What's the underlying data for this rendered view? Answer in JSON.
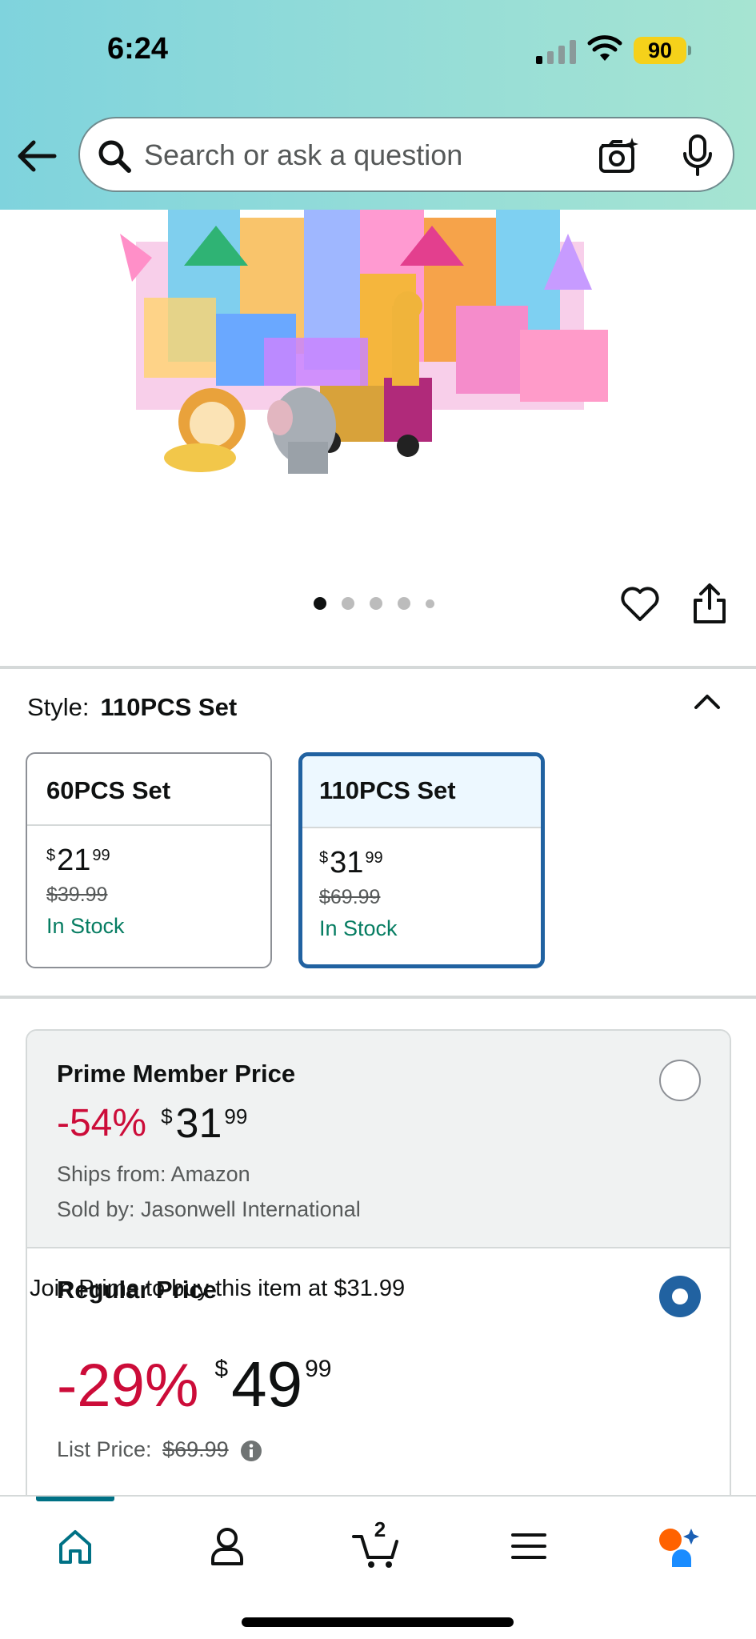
{
  "status_bar": {
    "time": "6:24",
    "battery": "90"
  },
  "search": {
    "placeholder": "Search or ask a question",
    "value": ""
  },
  "gallery": {
    "image_count": 5,
    "active_index": 0
  },
  "style": {
    "label": "Style:",
    "selected": "110PCS Set",
    "options": [
      {
        "name": "60PCS Set",
        "price_symbol": "$",
        "price_whole": "21",
        "price_fraction": "99",
        "list_price": "$39.99",
        "availability": "In Stock"
      },
      {
        "name": "110PCS Set",
        "price_symbol": "$",
        "price_whole": "31",
        "price_fraction": "99",
        "list_price": "$69.99",
        "availability": "In Stock"
      }
    ]
  },
  "offers": {
    "prime": {
      "title": "Prime Member Price",
      "discount": "-54%",
      "price_symbol": "$",
      "price_whole": "31",
      "price_fraction": "99",
      "ships_from": "Ships from: Amazon",
      "sold_by": "Sold by: Jasonwell International",
      "selected": false
    },
    "regular": {
      "title": "Regular Price",
      "discount": "-29%",
      "price_symbol": "$",
      "price_whole": "49",
      "price_fraction": "99",
      "list_price_label": "List Price:",
      "list_price": "$69.99",
      "join_prime_text": "Join Prime to buy this item at $31.99",
      "selected": true
    }
  },
  "bottom_nav": {
    "cart_count": "2",
    "active": "home"
  },
  "colors": {
    "accent_blue": "#2162a1",
    "discount_red": "#cc0c39",
    "in_stock_green": "#067d62",
    "nav_teal": "#007185",
    "header_gradient_start": "#7fd3dd",
    "header_gradient_end": "#a6e4d2"
  }
}
